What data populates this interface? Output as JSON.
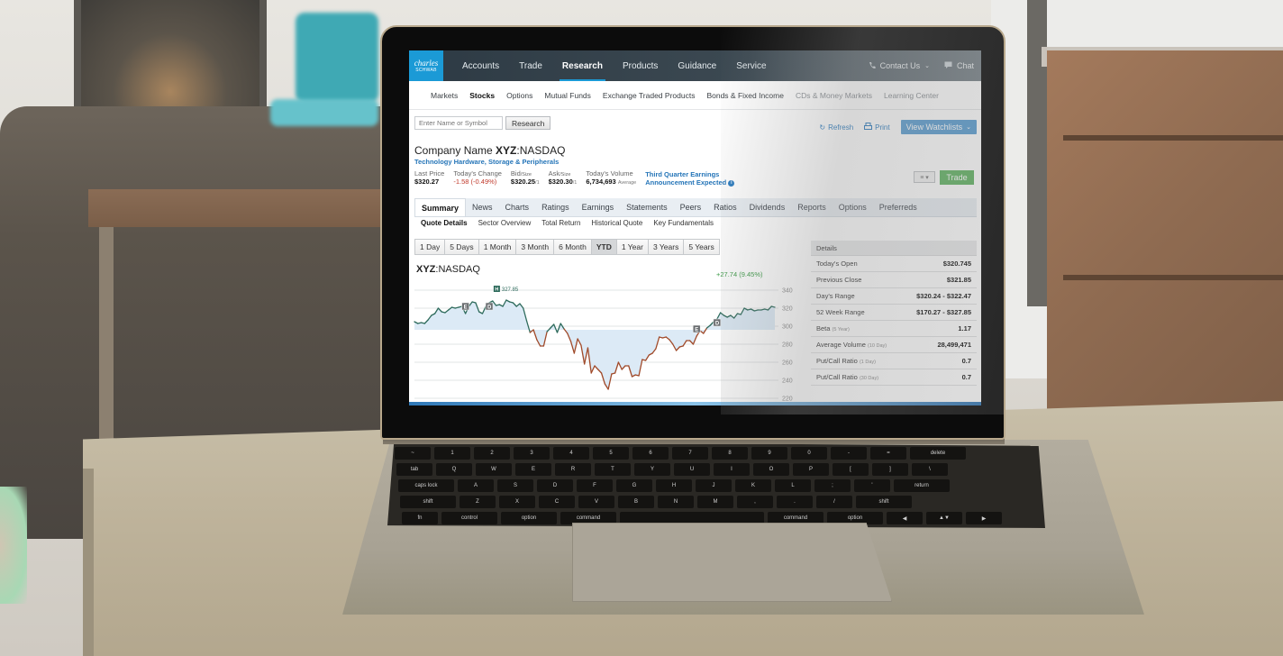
{
  "site": {
    "logo_line1": "charles",
    "logo_line2": "SCHWAB",
    "accent_color": "#1b9ad6"
  },
  "topnav": {
    "items": [
      {
        "label": "Accounts",
        "active": false
      },
      {
        "label": "Trade",
        "active": false
      },
      {
        "label": "Research",
        "active": true
      },
      {
        "label": "Products",
        "active": false
      },
      {
        "label": "Guidance",
        "active": false
      },
      {
        "label": "Service",
        "active": false
      }
    ],
    "contact_label": "Contact Us",
    "contact_icon": "phone-icon",
    "chat_label": "Chat",
    "chat_icon": "chat-bubble-icon"
  },
  "subnav": {
    "items": [
      {
        "label": "Markets",
        "state": "normal"
      },
      {
        "label": "Stocks",
        "state": "active"
      },
      {
        "label": "Options",
        "state": "normal"
      },
      {
        "label": "Mutual Funds",
        "state": "normal"
      },
      {
        "label": "Exchange Traded Products",
        "state": "normal"
      },
      {
        "label": "Bonds & Fixed Income",
        "state": "normal"
      },
      {
        "label": "CDs & Money Markets",
        "state": "muted"
      },
      {
        "label": "Learning Center",
        "state": "muted"
      }
    ]
  },
  "search": {
    "placeholder": "Enter Name or Symbol",
    "value": "",
    "button_label": "Research"
  },
  "tools": {
    "refresh_label": "Refresh",
    "print_label": "Print",
    "watchlists_label": "View Watchlists"
  },
  "company": {
    "name_prefix": "Company Name",
    "symbol": "XYZ",
    "exchange": ":NASDAQ",
    "sector": "Technology Hardware, Storage & Peripherals"
  },
  "quote": {
    "last_price_label": "Last Price",
    "last_price": "$320.27",
    "change_label": "Today's Change",
    "change": "-1.58 (-0.49%)",
    "bid_label": "Bid",
    "bid_size_label": "/Size",
    "bid": "$320.25",
    "bid_size": "/1",
    "ask_label": "Ask",
    "ask_size_label": "/Size",
    "ask": "$320.30",
    "ask_size": "/1",
    "volume_label": "Today's Volume",
    "volume": "6,734,693",
    "volume_note": "Average",
    "earnings_line1": "Third Quarter Earnings",
    "earnings_line2": "Announcement Expected",
    "info_icon": "i",
    "menu_icon": "≡ ▾",
    "trade_label": "Trade",
    "trade_color": "#62b464"
  },
  "tabs": [
    {
      "label": "Summary",
      "active": true
    },
    {
      "label": "News",
      "active": false
    },
    {
      "label": "Charts",
      "active": false
    },
    {
      "label": "Ratings",
      "active": false
    },
    {
      "label": "Earnings",
      "active": false
    },
    {
      "label": "Statements",
      "active": false
    },
    {
      "label": "Peers",
      "active": false
    },
    {
      "label": "Ratios",
      "active": false
    },
    {
      "label": "Dividends",
      "active": false
    },
    {
      "label": "Reports",
      "active": false
    },
    {
      "label": "Options",
      "active": false
    },
    {
      "label": "Preferreds",
      "active": false
    }
  ],
  "subtabs": [
    {
      "label": "Quote Details",
      "active": true
    },
    {
      "label": "Sector Overview",
      "active": false
    },
    {
      "label": "Total Return",
      "active": false
    },
    {
      "label": "Historical Quote",
      "active": false
    },
    {
      "label": "Key Fundamentals",
      "active": false
    }
  ],
  "ranges": [
    {
      "label": "1 Day",
      "active": false
    },
    {
      "label": "5 Days",
      "active": false
    },
    {
      "label": "1 Month",
      "active": false
    },
    {
      "label": "3 Month",
      "active": false
    },
    {
      "label": "6 Month",
      "active": false
    },
    {
      "label": "YTD",
      "active": true
    },
    {
      "label": "1 Year",
      "active": false
    },
    {
      "label": "3 Years",
      "active": false
    },
    {
      "label": "5 Years",
      "active": false
    }
  ],
  "chart_data": {
    "type": "line",
    "title_symbol": "XYZ",
    "title_exchange": ":NASDAQ",
    "change_label": "+27.74 (9.45%)",
    "ylim": [
      220,
      340
    ],
    "yticks": [
      340,
      320,
      300,
      280,
      260,
      240,
      220
    ],
    "baseline": 296,
    "grid": true,
    "y_axis_position": "right",
    "up_color": "#2e6b5c",
    "down_color": "#a04a2a",
    "fill_color": "#dceaf6",
    "high_marker": {
      "label": "H",
      "value": "327.85"
    },
    "event_markers": [
      {
        "label": "E",
        "index": 15
      },
      {
        "label": "D",
        "index": 22
      },
      {
        "label": "E",
        "index": 83
      },
      {
        "label": "D",
        "index": 89
      }
    ],
    "values": [
      305,
      303,
      304,
      303,
      307,
      312,
      314,
      320,
      316,
      315,
      318,
      321,
      320,
      321,
      322,
      314,
      322,
      327,
      326,
      316,
      314,
      322,
      326,
      328,
      323,
      324,
      322,
      329,
      327,
      326,
      322,
      325,
      320,
      306,
      293,
      296,
      285,
      278,
      278,
      294,
      298,
      302,
      293,
      303,
      297,
      292,
      283,
      270,
      286,
      279,
      258,
      276,
      248,
      256,
      252,
      248,
      236,
      230,
      247,
      248,
      260,
      252,
      256,
      256,
      244,
      246,
      245,
      263,
      262,
      268,
      270,
      275,
      288,
      287,
      288,
      285,
      280,
      273,
      277,
      278,
      284,
      284,
      280,
      289,
      295,
      292,
      298,
      301,
      305,
      308,
      315,
      312,
      310,
      312,
      309,
      314,
      313,
      320,
      318,
      319,
      317,
      318,
      318,
      319,
      318,
      322,
      321
    ]
  },
  "details": {
    "title": "Details",
    "rows": [
      {
        "label": "Today's Open",
        "note": "",
        "value": "$320.745"
      },
      {
        "label": "Previous Close",
        "note": "",
        "value": "$321.85"
      },
      {
        "label": "Day's Range",
        "note": "",
        "value": "$320.24 - $322.47"
      },
      {
        "label": "52 Week Range",
        "note": "",
        "value": "$170.27 - $327.85"
      },
      {
        "label": "Beta",
        "note": "(5 Year)",
        "value": "1.17"
      },
      {
        "label": "Average Volume",
        "note": "(10 Day)",
        "value": "28,499,471"
      },
      {
        "label": "Put/Call Ratio",
        "note": "(1 Day)",
        "value": "0.7"
      },
      {
        "label": "Put/Call Ratio",
        "note": "(30 Day)",
        "value": "0.7"
      }
    ]
  },
  "keyboard": {
    "rows": [
      [
        "~",
        "1",
        "2",
        "3",
        "4",
        "5",
        "6",
        "7",
        "8",
        "9",
        "0",
        "-",
        "=",
        "delete"
      ],
      [
        "tab",
        "Q",
        "W",
        "E",
        "R",
        "T",
        "Y",
        "U",
        "I",
        "O",
        "P",
        "[",
        "]",
        "\\"
      ],
      [
        "caps lock",
        "A",
        "S",
        "D",
        "F",
        "G",
        "H",
        "J",
        "K",
        "L",
        ";",
        "'",
        "return"
      ],
      [
        "shift",
        "Z",
        "X",
        "C",
        "V",
        "B",
        "N",
        "M",
        ",",
        ".",
        "/",
        "shift"
      ],
      [
        "fn",
        "control",
        "option",
        "command",
        "",
        "command",
        "option",
        "◀",
        "▲▼",
        "▶"
      ]
    ]
  }
}
